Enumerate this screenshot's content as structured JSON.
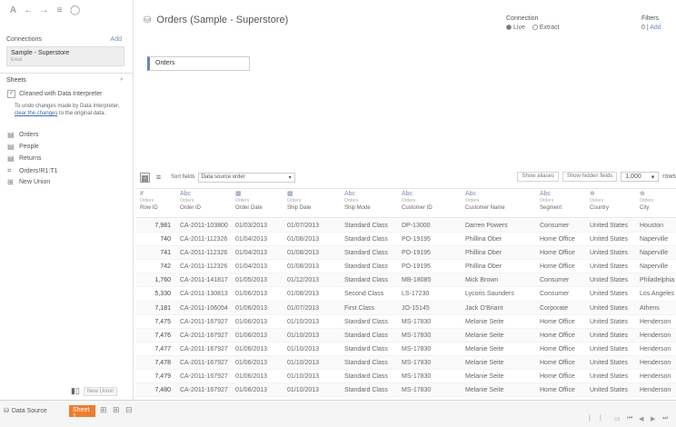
{
  "toolbar_icons": [
    "A",
    "←",
    "→",
    "≡",
    "◯"
  ],
  "connections": {
    "heading": "Connections",
    "add_label": "Add",
    "items": [
      {
        "name": "Sample - Superstore",
        "type": "Excel"
      }
    ]
  },
  "sheets": {
    "heading": "Sheets",
    "use_interpreter_label": "Cleaned with Data Interpreter",
    "help_text_pre": "To undo changes made by Data Interpreter, ",
    "help_link": "clear the changes",
    "help_text_post": " to the original data.",
    "items": [
      {
        "icon": "table-icon",
        "label": "Orders"
      },
      {
        "icon": "table-icon",
        "label": "People"
      },
      {
        "icon": "table-icon",
        "label": "Returns"
      },
      {
        "icon": "named-range-icon",
        "label": "Orders!R1:T1"
      },
      {
        "icon": "union-icon",
        "label": "New Union"
      }
    ]
  },
  "new_union_label": "New Union",
  "title": "Orders (Sample - Superstore)",
  "connection": {
    "label": "Connection",
    "live": "Live",
    "extract": "Extract",
    "selected": "live"
  },
  "filters": {
    "label": "Filters",
    "count": "0",
    "separator": "|",
    "add": "Add"
  },
  "canvas_table": "Orders",
  "grid_toolbar": {
    "sort_label": "Sort fields",
    "sort_value": "Data source order",
    "show_aliases": "Show aliases",
    "show_hidden": "Show hidden fields",
    "rows_value": "1,000",
    "rows_word": "rows"
  },
  "columns": [
    {
      "type": "#",
      "source": "Orders",
      "name": "Row ID"
    },
    {
      "type": "Abc",
      "source": "Orders",
      "name": "Order ID"
    },
    {
      "type": "▦",
      "source": "Orders",
      "name": "Order Date"
    },
    {
      "type": "▦",
      "source": "Orders",
      "name": "Ship Date"
    },
    {
      "type": "Abc",
      "source": "Orders",
      "name": "Ship Mode"
    },
    {
      "type": "Abc",
      "source": "Orders",
      "name": "Customer ID"
    },
    {
      "type": "Abc",
      "source": "Orders",
      "name": "Customer Name"
    },
    {
      "type": "Abc",
      "source": "Orders",
      "name": "Segment"
    },
    {
      "type": "⊕",
      "source": "Orders",
      "name": "Country"
    },
    {
      "type": "⊕",
      "source": "Orders",
      "name": "City"
    }
  ],
  "rows": [
    [
      "7,981",
      "CA-2011-103800",
      "01/03/2013",
      "01/07/2013",
      "Standard Class",
      "DP-13000",
      "Darren Powers",
      "Consumer",
      "United States",
      "Houston"
    ],
    [
      "740",
      "CA-2011-112326",
      "01/04/2013",
      "01/08/2013",
      "Standard Class",
      "PO-19195",
      "Phillina Ober",
      "Home Office",
      "United States",
      "Naperville"
    ],
    [
      "741",
      "CA-2011-112326",
      "01/04/2013",
      "01/08/2013",
      "Standard Class",
      "PO-19195",
      "Phillina Ober",
      "Home Office",
      "United States",
      "Naperville"
    ],
    [
      "742",
      "CA-2011-112326",
      "01/04/2013",
      "01/08/2013",
      "Standard Class",
      "PO-19195",
      "Phillina Ober",
      "Home Office",
      "United States",
      "Naperville"
    ],
    [
      "1,760",
      "CA-2011-141817",
      "01/05/2013",
      "01/12/2013",
      "Standard Class",
      "MB-18085",
      "Mick Brown",
      "Consumer",
      "United States",
      "Philadelphia"
    ],
    [
      "5,330",
      "CA-2011-130813",
      "01/06/2013",
      "01/08/2013",
      "Second Class",
      "LS-17230",
      "Lycoris Saunders",
      "Consumer",
      "United States",
      "Los Angeles"
    ],
    [
      "7,181",
      "CA-2011-106054",
      "01/06/2013",
      "01/07/2013",
      "First Class",
      "JO-15145",
      "Jack O'Briant",
      "Corporate",
      "United States",
      "Athens"
    ],
    [
      "7,475",
      "CA-2011-167927",
      "01/06/2013",
      "01/10/2013",
      "Standard Class",
      "MS-17830",
      "Melanie Seite",
      "Home Office",
      "United States",
      "Henderson"
    ],
    [
      "7,476",
      "CA-2011-167927",
      "01/06/2013",
      "01/10/2013",
      "Standard Class",
      "MS-17830",
      "Melanie Seite",
      "Home Office",
      "United States",
      "Henderson"
    ],
    [
      "7,477",
      "CA-2011-167927",
      "01/06/2013",
      "01/10/2013",
      "Standard Class",
      "MS-17830",
      "Melanie Seite",
      "Home Office",
      "United States",
      "Henderson"
    ],
    [
      "7,478",
      "CA-2011-167927",
      "01/06/2013",
      "01/10/2013",
      "Standard Class",
      "MS-17830",
      "Melanie Seite",
      "Home Office",
      "United States",
      "Henderson"
    ],
    [
      "7,479",
      "CA-2011-167927",
      "01/06/2013",
      "01/10/2013",
      "Standard Class",
      "MS-17830",
      "Melanie Seite",
      "Home Office",
      "United States",
      "Henderson"
    ],
    [
      "7,480",
      "CA-2011-167927",
      "01/06/2013",
      "01/10/2013",
      "Standard Class",
      "MS-17830",
      "Melanie Seite",
      "Home Office",
      "United States",
      "Henderson"
    ]
  ],
  "bottom": {
    "data_source_label": "Data Source",
    "sheet_tab": "Sheet 1"
  },
  "colors": {
    "accent_orange": "#ed7d31",
    "link_blue": "#3b6ab0",
    "type_icon_blue": "#7b8fb0"
  }
}
